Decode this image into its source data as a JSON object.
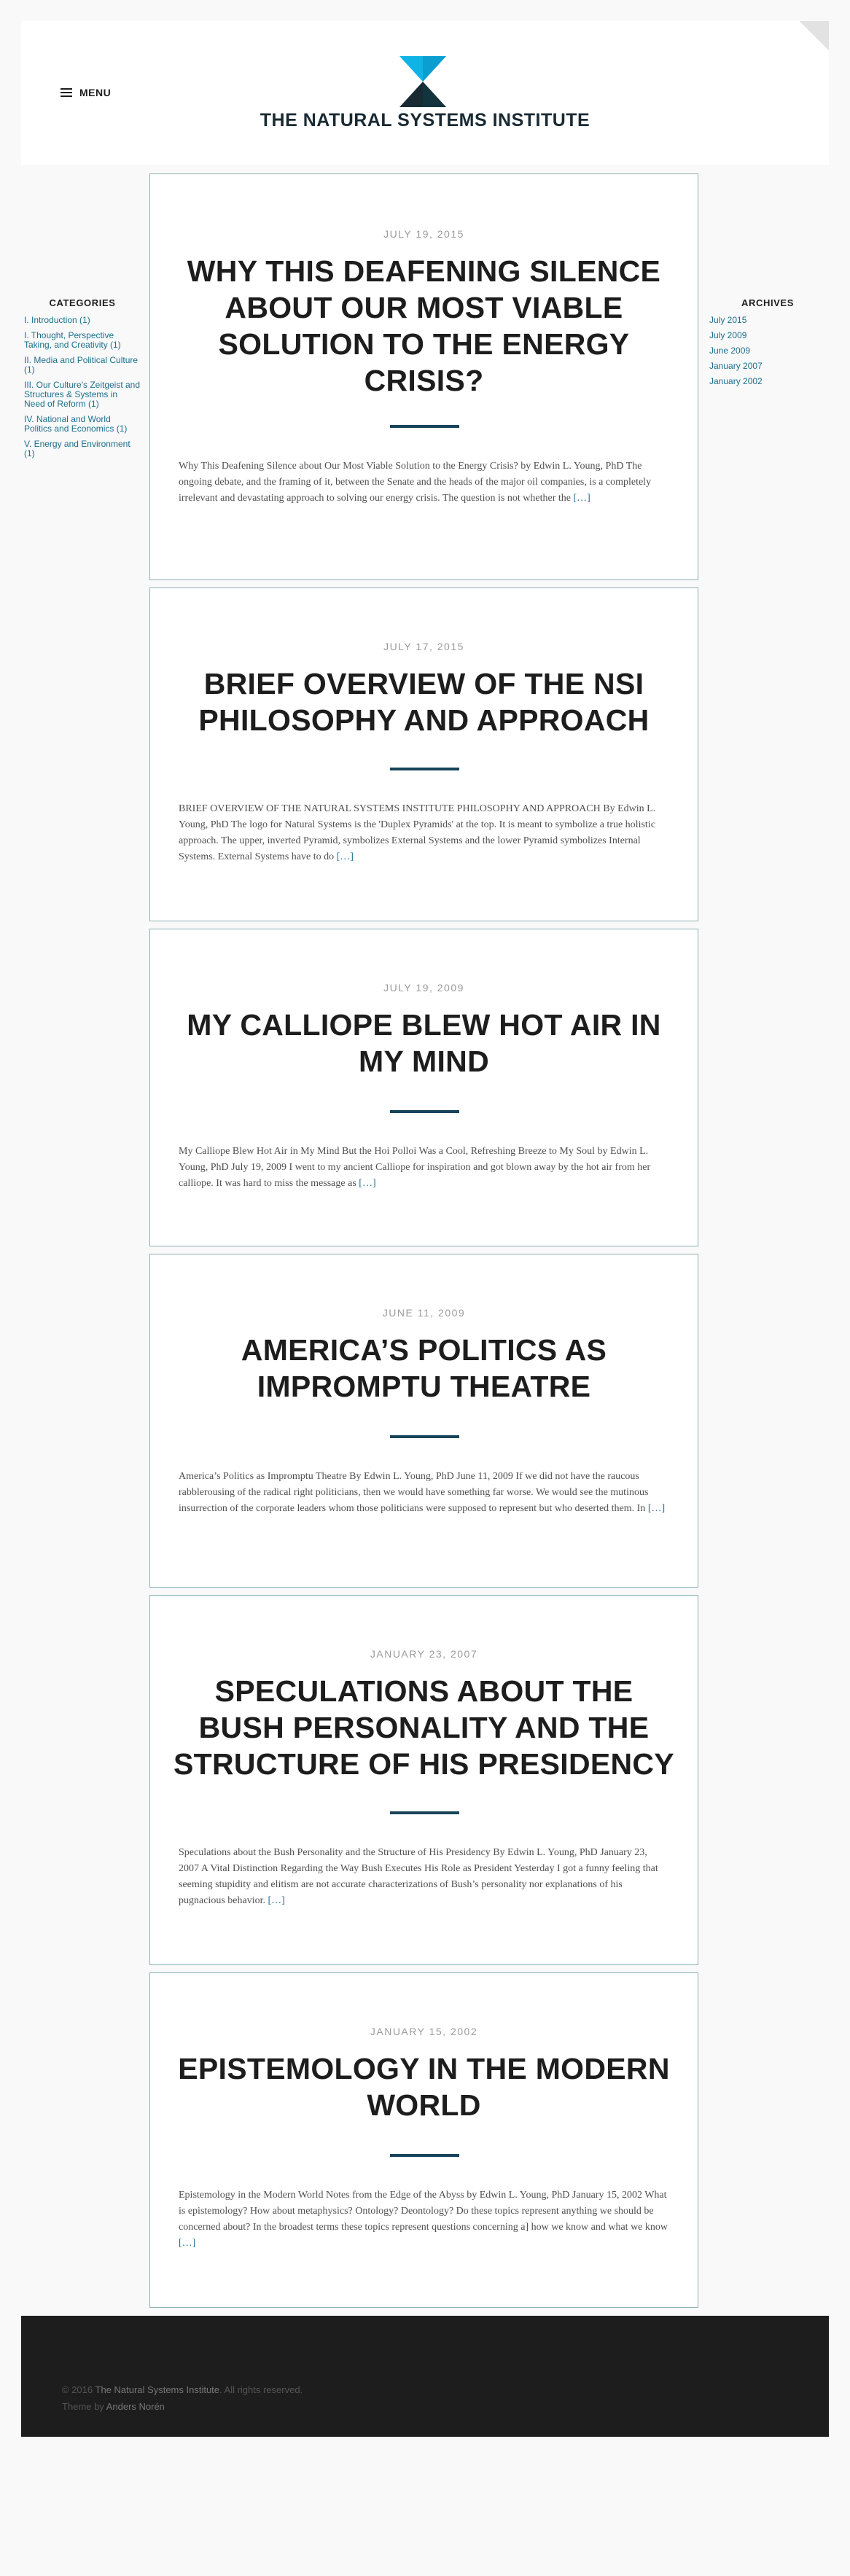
{
  "header": {
    "menu_label": "MENU",
    "site_title": "THE NATURAL SYSTEMS INSTITUTE"
  },
  "categories": {
    "title": "CATEGORIES",
    "items": [
      {
        "label": "I. Introduction (1)"
      },
      {
        "label": "I. Thought, Perspective Taking, and Creativity (1)"
      },
      {
        "label": "II. Media and Political Culture (1)"
      },
      {
        "label": "III. Our Culture's Zeitgeist and Structures & Systems in Need of Reform (1)"
      },
      {
        "label": "IV. National and World Politics and Economics (1)"
      },
      {
        "label": "V. Energy and Environment (1)"
      }
    ]
  },
  "archives": {
    "title": "ARCHIVES",
    "items": [
      {
        "label": "July 2015"
      },
      {
        "label": "July 2009"
      },
      {
        "label": "June 2009"
      },
      {
        "label": "January 2007"
      },
      {
        "label": "January 2002"
      }
    ]
  },
  "posts": [
    {
      "date": "JULY 19, 2015",
      "title": "WHY THIS DEAFENING SILENCE ABOUT OUR MOST VIABLE SOLUTION TO THE ENERGY CRISIS?",
      "excerpt": "Why This Deafening Silence about Our Most Viable Solution to the Energy Crisis? by Edwin L. Young, PhD The ongoing debate, and the framing of it, between the Senate and the heads of the major oil companies, is a completely irrelevant and devastating approach to solving our energy crisis. The question is not whether the ",
      "more": "[…]"
    },
    {
      "date": "JULY 17, 2015",
      "title": "BRIEF OVERVIEW OF THE NSI PHILOSOPHY AND APPROACH",
      "excerpt": "BRIEF OVERVIEW OF THE NATURAL SYSTEMS INSTITUTE PHILOSOPHY AND APPROACH By Edwin L. Young, PhD The logo for Natural Systems is the 'Duplex Pyramids' at the top. It is meant to symbolize a true holistic approach. The upper, inverted Pyramid, symbolizes External Systems and the lower Pyramid symbolizes Internal Systems. External Systems have to do ",
      "more": "[…]"
    },
    {
      "date": "JULY 19, 2009",
      "title": "MY CALLIOPE BLEW HOT AIR IN MY MIND",
      "excerpt": "My Calliope Blew Hot Air in My Mind But the Hoi Polloi Was a Cool, Refreshing Breeze to My Soul by Edwin L. Young, PhD July 19, 2009 I went to my ancient Calliope for inspiration and got blown away by the hot air from her calliope. It was hard to miss the message as ",
      "more": "[…]"
    },
    {
      "date": "JUNE 11, 2009",
      "title": "AMERICA’S POLITICS AS IMPROMPTU THEATRE",
      "excerpt": "America’s Politics as Impromptu Theatre By Edwin L. Young, PhD June 11, 2009 If we did not have the raucous rabblerousing of the radical right politicians, then we would have something far worse.   We would see the mutinous insurrection of the corporate leaders whom those politicians were supposed to represent but who deserted them.    In ",
      "more": "[…]"
    },
    {
      "date": "JANUARY 23, 2007",
      "title": "SPECULATIONS ABOUT THE BUSH PERSONALITY AND THE STRUCTURE OF HIS PRESIDENCY",
      "excerpt": "Speculations about the Bush Personality and the Structure of His Presidency By Edwin L. Young, PhD January 23, 2007 A Vital Distinction Regarding the Way Bush Executes His Role as President Yesterday I got a funny feeling that seeming stupidity and elitism are not accurate characterizations of Bush’s personality nor explanations of his pugnacious behavior. ",
      "more": "[…]"
    },
    {
      "date": "JANUARY 15, 2002",
      "title": "EPISTEMOLOGY IN THE MODERN WORLD",
      "excerpt": "Epistemology in the Modern World Notes from the Edge of the Abyss by Edwin L. Young, PhD January 15, 2002 What is epistemology? How about metaphysics? Ontology? Deontology? Do these topics represent anything we should be concerned about? In the broadest terms these topics represent questions concerning a] how we know and what we know ",
      "more": "[…]"
    }
  ],
  "footer": {
    "copyright_prefix": "© 2016 ",
    "site_link": "The Natural Systems Institute",
    "copyright_suffix": ". All rights reserved.",
    "theme_prefix": "Theme by ",
    "theme_link": "Anders Norén"
  },
  "colors": {
    "accent": "#1c6e8c",
    "divider": "#17445a",
    "logo_light": "#0fb3e6",
    "logo_dark": "#1a2a33"
  }
}
